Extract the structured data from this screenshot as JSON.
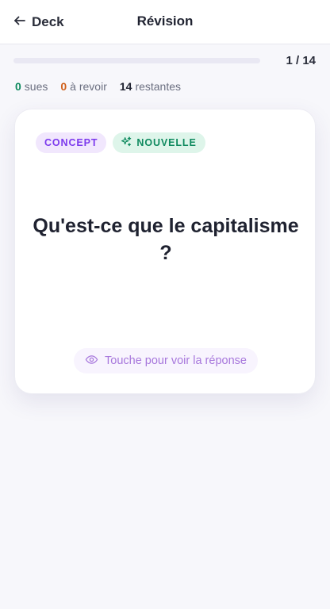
{
  "header": {
    "back_label": "Deck",
    "title": "Révision"
  },
  "progress": {
    "count_text": "1 / 14",
    "fraction": 0.0
  },
  "stats": {
    "known_count": "0",
    "known_label": "sues",
    "review_count": "0",
    "review_label": "à revoir",
    "remaining_count": "14",
    "remaining_label": "restantes"
  },
  "card": {
    "badge_concept": "CONCEPT",
    "badge_new": "NOUVELLE",
    "question": "Qu'est-ce que le capitalisme ?",
    "reveal_label": "Touche pour voir la réponse"
  },
  "icons": {
    "back": "arrow-left-icon",
    "new": "sparkles-icon",
    "reveal": "eye-icon"
  },
  "colors": {
    "accent": "#7c3aed",
    "known": "#0f8a5f",
    "review": "#d0601b",
    "background": "#f7f7fb"
  }
}
